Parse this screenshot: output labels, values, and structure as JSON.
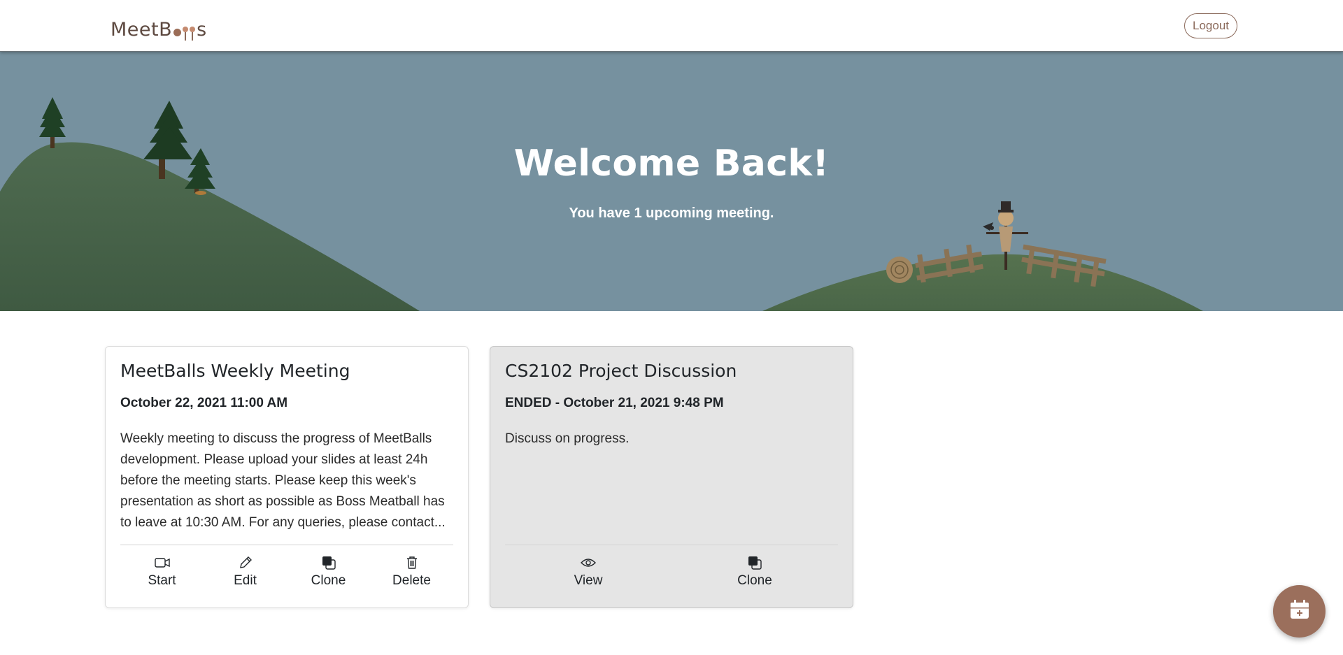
{
  "navbar": {
    "brand_name": "MeetBalls",
    "brand_prefix": "MeetB",
    "brand_suffix": "s",
    "logout_label": "Logout"
  },
  "hero": {
    "title": "Welcome Back!",
    "subtitle": "You have 1 upcoming meeting."
  },
  "meetings": [
    {
      "title": "MeetBalls Weekly Meeting",
      "date": "October 22, 2021 11:00 AM",
      "description": "Weekly meeting to discuss the progress of MeetBalls development. Please upload your slides at least 24h before the meeting starts. Please keep this week's presentation as short as possible as Boss Meatball has to leave at 10:30 AM. For any queries, please contact...",
      "actions": [
        {
          "label": "Start",
          "icon": "video-icon"
        },
        {
          "label": "Edit",
          "icon": "pencil-icon"
        },
        {
          "label": "Clone",
          "icon": "copy-icon"
        },
        {
          "label": "Delete",
          "icon": "trash-icon"
        }
      ]
    },
    {
      "title": "CS2102 Project Discussion",
      "date": "ENDED - October 21, 2021 9:48 PM",
      "description": "Discuss on progress.",
      "actions": [
        {
          "label": "View",
          "icon": "eye-icon"
        },
        {
          "label": "Clone",
          "icon": "copy-icon"
        }
      ]
    }
  ],
  "fab": {
    "icon": "calendar-plus-icon"
  },
  "colors": {
    "brand": "#9b6f5c",
    "hero_sky": "#76919f",
    "hill": "#4e6a4f",
    "ended_card": "#e5e5e5"
  }
}
